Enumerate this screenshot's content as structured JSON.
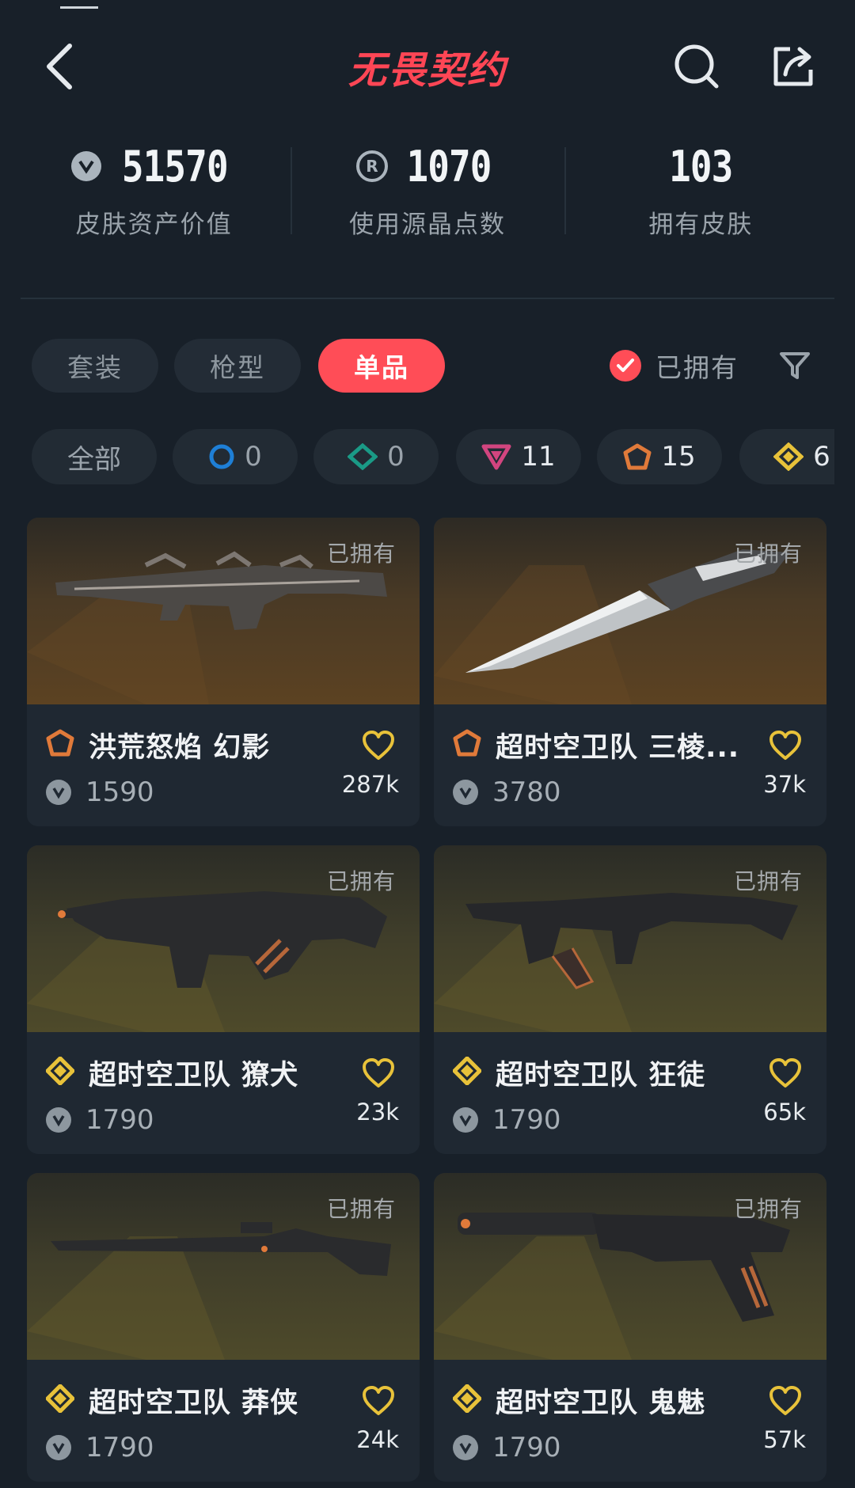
{
  "header": {
    "title": "无畏契约"
  },
  "stats": [
    {
      "value": "51570",
      "label": "皮肤资产价值",
      "icon": "valorant-points-icon"
    },
    {
      "value": "1070",
      "label": "使用源晶点数",
      "icon": "radianite-points-icon"
    },
    {
      "value": "103",
      "label": "拥有皮肤",
      "icon": ""
    }
  ],
  "tabs": [
    {
      "label": "套装",
      "active": false
    },
    {
      "label": "枪型",
      "active": false
    },
    {
      "label": "单品",
      "active": true
    }
  ],
  "owned_filter": {
    "label": "已拥有",
    "checked": true
  },
  "chips": [
    {
      "label": "全部",
      "icon": ""
    },
    {
      "label": "0",
      "icon": "select-tier-icon",
      "color": "#1e7fd6"
    },
    {
      "label": "0",
      "icon": "deluxe-tier-icon",
      "color": "#1a9a86"
    },
    {
      "label": "11",
      "icon": "premium-tier-icon",
      "color": "#d2457f"
    },
    {
      "label": "15",
      "icon": "exclusive-tier-icon",
      "color": "#e07a3a"
    },
    {
      "label": "6",
      "icon": "ultra-tier-icon",
      "color": "#e8c23a"
    }
  ],
  "cards": [
    {
      "owned": "已拥有",
      "name": "洪荒怒焰 幻影",
      "tier": "exclusive",
      "price": "1590",
      "likes": "287k",
      "bg": "brown"
    },
    {
      "owned": "已拥有",
      "name": "超时空卫队 三棱...",
      "tier": "exclusive",
      "price": "3780",
      "likes": "37k",
      "bg": "brown"
    },
    {
      "owned": "已拥有",
      "name": "超时空卫队 獠犬",
      "tier": "ultra",
      "price": "1790",
      "likes": "23k",
      "bg": "olive"
    },
    {
      "owned": "已拥有",
      "name": "超时空卫队 狂徒",
      "tier": "ultra",
      "price": "1790",
      "likes": "65k",
      "bg": "olive"
    },
    {
      "owned": "已拥有",
      "name": "超时空卫队 莽侠",
      "tier": "ultra",
      "price": "1790",
      "likes": "24k",
      "bg": "olive"
    },
    {
      "owned": "已拥有",
      "name": "超时空卫队 鬼魅",
      "tier": "ultra",
      "price": "1790",
      "likes": "57k",
      "bg": "olive"
    }
  ],
  "colors": {
    "accent": "#ff4d57",
    "background": "#182029",
    "card": "#1f2832"
  }
}
